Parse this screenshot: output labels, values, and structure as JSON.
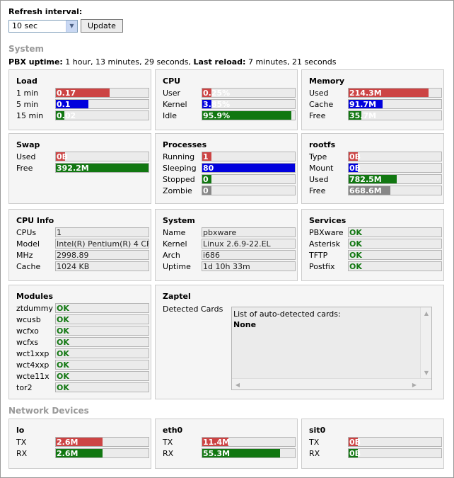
{
  "colors": {
    "red": "#cc4444",
    "blue": "#0000dd",
    "green": "#117711",
    "gray": "#888888",
    "ok": "#117711"
  },
  "refresh": {
    "label": "Refresh interval:",
    "selected": "10 sec",
    "update_label": "Update"
  },
  "system_heading": "System",
  "uptime": {
    "pbx_label": "PBX uptime:",
    "pbx_value": " 1 hour, 13 minutes, 29 seconds, ",
    "reload_label": "Last reload:",
    "reload_value": " 7 minutes, 21 seconds"
  },
  "load": {
    "title": "Load",
    "rows": [
      {
        "label": "1 min",
        "value": "0.17",
        "fraction": 0.58,
        "color": "red"
      },
      {
        "label": "5 min",
        "value": "0.1",
        "fraction": 0.35,
        "color": "blue"
      },
      {
        "label": "15 min",
        "value": "0.02",
        "fraction": 0.09,
        "color": "green"
      }
    ]
  },
  "cpu": {
    "title": "CPU",
    "rows": [
      {
        "label": "User",
        "value": "0.25%",
        "fraction": 0.1,
        "color": "red"
      },
      {
        "label": "Kernel",
        "value": "3.85%",
        "fraction": 0.1,
        "color": "blue"
      },
      {
        "label": "Idle",
        "value": "95.9%",
        "fraction": 0.959,
        "color": "green"
      }
    ]
  },
  "memory": {
    "title": "Memory",
    "rows": [
      {
        "label": "Used",
        "value": "214.3M",
        "fraction": 0.86,
        "color": "red"
      },
      {
        "label": "Cache",
        "value": "91.7M",
        "fraction": 0.37,
        "color": "blue"
      },
      {
        "label": "Free",
        "value": "35.7M",
        "fraction": 0.14,
        "color": "green"
      }
    ]
  },
  "swap": {
    "title": "Swap",
    "rows": [
      {
        "label": "Used",
        "value": "0B",
        "fraction": 0.1,
        "color": "red"
      },
      {
        "label": "Free",
        "value": "392.2M",
        "fraction": 1.0,
        "color": "green"
      }
    ]
  },
  "processes": {
    "title": "Processes",
    "rows": [
      {
        "label": "Running",
        "value": "1",
        "fraction": 0.1,
        "color": "red"
      },
      {
        "label": "Sleeping",
        "value": "80",
        "fraction": 1.0,
        "color": "blue"
      },
      {
        "label": "Stopped",
        "value": "0",
        "fraction": 0.1,
        "color": "green"
      },
      {
        "label": "Zombie",
        "value": "0",
        "fraction": 0.1,
        "color": "gray"
      }
    ]
  },
  "rootfs": {
    "title": "rootfs",
    "rows": [
      {
        "label": "Type",
        "value": "0B",
        "fraction": 0.1,
        "color": "red"
      },
      {
        "label": "Mount",
        "value": "0B",
        "fraction": 0.1,
        "color": "blue"
      },
      {
        "label": "Used",
        "value": "782.5M",
        "fraction": 0.52,
        "color": "green"
      },
      {
        "label": "Free",
        "value": "668.6M",
        "fraction": 0.45,
        "color": "gray"
      }
    ]
  },
  "cpuinfo": {
    "title": "CPU Info",
    "rows": [
      {
        "label": "CPUs",
        "value": "1"
      },
      {
        "label": "Model",
        "value": "Intel(R) Pentium(R) 4 CP"
      },
      {
        "label": "MHz",
        "value": "2998.89"
      },
      {
        "label": "Cache",
        "value": "1024 KB"
      }
    ]
  },
  "sysinfo": {
    "title": "System",
    "rows": [
      {
        "label": "Name",
        "value": "pbxware"
      },
      {
        "label": "Kernel",
        "value": "Linux 2.6.9-22.EL"
      },
      {
        "label": "Arch",
        "value": "i686"
      },
      {
        "label": "Uptime",
        "value": "1d 10h 33m"
      }
    ]
  },
  "services": {
    "title": "Services",
    "rows": [
      {
        "label": "PBXware",
        "value": "OK"
      },
      {
        "label": "Asterisk",
        "value": "OK"
      },
      {
        "label": "TFTP",
        "value": "OK"
      },
      {
        "label": "Postfix",
        "value": "OK"
      }
    ]
  },
  "modules": {
    "title": "Modules",
    "rows": [
      {
        "label": "ztdummy",
        "value": "OK"
      },
      {
        "label": "wcusb",
        "value": "OK"
      },
      {
        "label": "wcfxo",
        "value": "OK"
      },
      {
        "label": "wcfxs",
        "value": "OK"
      },
      {
        "label": "wct1xxp",
        "value": "OK"
      },
      {
        "label": "wct4xxp",
        "value": "OK"
      },
      {
        "label": "wcte11x",
        "value": "OK"
      },
      {
        "label": "tor2",
        "value": "OK"
      }
    ]
  },
  "zaptel": {
    "title": "Zaptel",
    "label": "Detected Cards",
    "list_caption": "List of auto-detected cards:",
    "list_value": "None"
  },
  "network_heading": "Network Devices",
  "lo": {
    "title": "lo",
    "rows": [
      {
        "label": "TX",
        "value": "2.6M",
        "fraction": 0.5,
        "color": "red"
      },
      {
        "label": "RX",
        "value": "2.6M",
        "fraction": 0.5,
        "color": "green"
      }
    ]
  },
  "eth0": {
    "title": "eth0",
    "rows": [
      {
        "label": "TX",
        "value": "11.4M",
        "fraction": 0.28,
        "color": "red"
      },
      {
        "label": "RX",
        "value": "55.3M",
        "fraction": 0.84,
        "color": "green"
      }
    ]
  },
  "sit0": {
    "title": "sit0",
    "rows": [
      {
        "label": "TX",
        "value": "0B",
        "fraction": 0.1,
        "color": "red"
      },
      {
        "label": "RX",
        "value": "0B",
        "fraction": 0.1,
        "color": "green"
      }
    ]
  }
}
